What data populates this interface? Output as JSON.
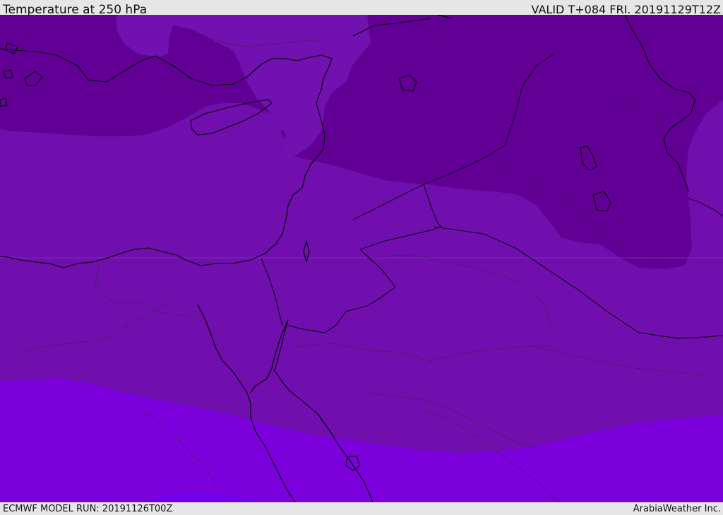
{
  "header": {
    "title": "Temperature at 250 hPa",
    "valid": "VALID T+084 FRI. 20191129T12Z"
  },
  "footer": {
    "model_run": "ECMWF MODEL RUN: 20191126T00Z",
    "credit": "ArabiaWeather Inc."
  },
  "map": {
    "fill_colors": {
      "coldest": "#620096",
      "cold": "#7011b0",
      "mid": "#700fad",
      "warm": "#7b00dc",
      "warmest": "#7000f0"
    },
    "boundary_color": "#000000"
  }
}
